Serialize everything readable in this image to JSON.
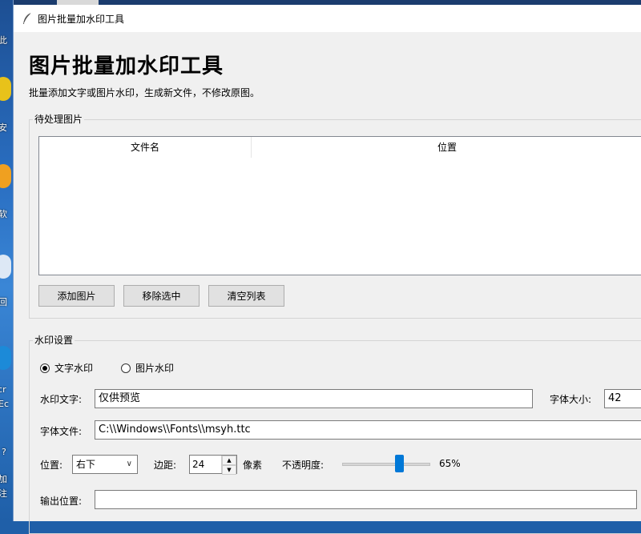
{
  "window": {
    "title": "图片批量加水印工具"
  },
  "desktop": {
    "labels": [
      "此",
      "安",
      "软",
      "回",
      "icr",
      "Ec",
      "?",
      "加",
      "注"
    ]
  },
  "header": {
    "title": "图片批量加水印工具",
    "subtitle": "批量添加文字或图片水印，生成新文件，不修改原图。"
  },
  "pending": {
    "group_label": "待处理图片",
    "columns": [
      "文件名",
      "位置"
    ],
    "buttons": {
      "add": "添加图片",
      "remove": "移除选中",
      "clear": "清空列表"
    }
  },
  "settings": {
    "group_label": "水印设置",
    "modes": {
      "text": "文字水印",
      "image": "图片水印",
      "selected": "text"
    },
    "watermark_text_label": "水印文字:",
    "watermark_text_value": "仅供预览",
    "font_size_label": "字体大小:",
    "font_size_value": "42",
    "font_file_label": "字体文件:",
    "font_file_value": "C:\\\\Windows\\\\Fonts\\\\msyh.ttc",
    "position_label": "位置:",
    "position_value": "右下",
    "margin_label": "边距:",
    "margin_value": "24",
    "margin_unit": "像素",
    "opacity_label": "不透明度:",
    "opacity_text": "65%",
    "opacity_value": 0.65,
    "output_label": "输出位置:",
    "output_value": ""
  },
  "colors": {
    "accent": "#0078d7"
  }
}
